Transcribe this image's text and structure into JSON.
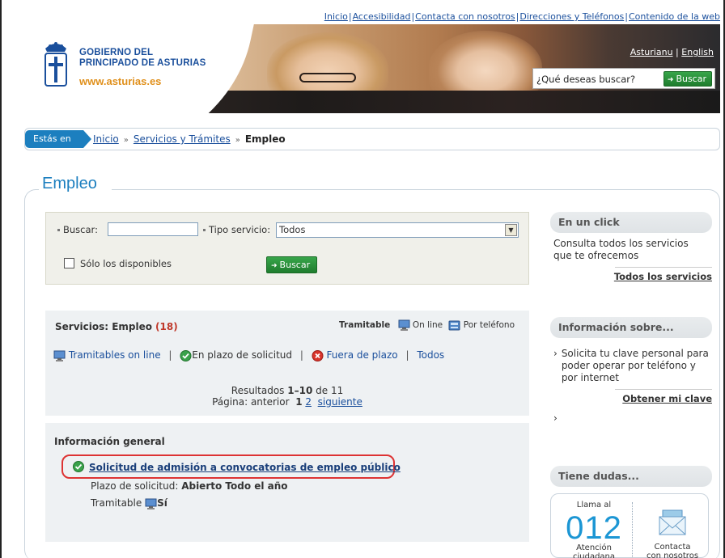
{
  "header": {
    "top_links": [
      "Inicio",
      "Accesibilidad",
      "Contacta con nosotros",
      "Direcciones y Teléfonos",
      "Contenido de la web"
    ],
    "logo_line1": "GOBIERNO DEL",
    "logo_line2": "PRINCIPADO DE ASTURIAS",
    "logo_url_text": "www.asturias.es",
    "lang_asturianu": "Asturianu",
    "lang_sep": "|",
    "lang_english": "English",
    "search_question": "¿Qué deseas buscar?",
    "search_button": "Buscar"
  },
  "breadcrumb": {
    "tag": "Estás en",
    "items": [
      "Inicio",
      "Servicios y Trámites"
    ],
    "current": "Empleo"
  },
  "page_title": "Empleo",
  "filter": {
    "buscar_label": "Buscar:",
    "buscar_value": "",
    "tipo_label": "Tipo servicio:",
    "tipo_value": "Todos",
    "solo_disponibles_label": "Sólo los disponibles",
    "solo_disponibles_checked": false,
    "button": "Buscar"
  },
  "services": {
    "heading": "Servicios: Empleo",
    "count": "(18)",
    "tramitable_label": "Tramitable",
    "online_label": "On line",
    "phone_label": "Por teléfono",
    "filter_online": "Tramitables on line",
    "filter_plazo": "En plazo de solicitud",
    "filter_fuera": "Fuera de plazo",
    "filter_todos": "Todos",
    "results_prefix": "Resultados",
    "results_range": "1–10",
    "results_of": "de 11",
    "page_label": "Página:",
    "page_prev": "anterior",
    "page_current": "1",
    "page_next_num": "2",
    "page_next": "siguiente"
  },
  "info_general": {
    "heading": "Información general",
    "item_title": "Solicitud de admisión a convocatorias de empleo público",
    "plazo_label": "Plazo de solicitud:",
    "plazo_value": "Abierto Todo el año",
    "tramitable_label": "Tramitable",
    "tramitable_value": "Sí"
  },
  "sidebar": {
    "click_title": "En un click",
    "click_text": "Consulta todos los servicios que te ofrecemos",
    "click_link": "Todos los servicios",
    "info_title": "Información sobre...",
    "info_text": "Solicita tu clave personal para poder operar por teléfono y por internet",
    "info_link": "Obtener mi clave",
    "dudas_title": "Tiene dudas...",
    "llama": "Llama al",
    "number": "012",
    "atencion_line1": "Atención",
    "atencion_line2": "ciudadana",
    "contacta_line1": "Contacta",
    "contacta_line2": "con nosotros"
  },
  "colors": {
    "accent_blue": "#1c7fbf",
    "link_blue": "#1a4f9c",
    "button_green": "#2a8f3b",
    "highlight_red": "#dd3333",
    "count_red": "#c0392b"
  }
}
